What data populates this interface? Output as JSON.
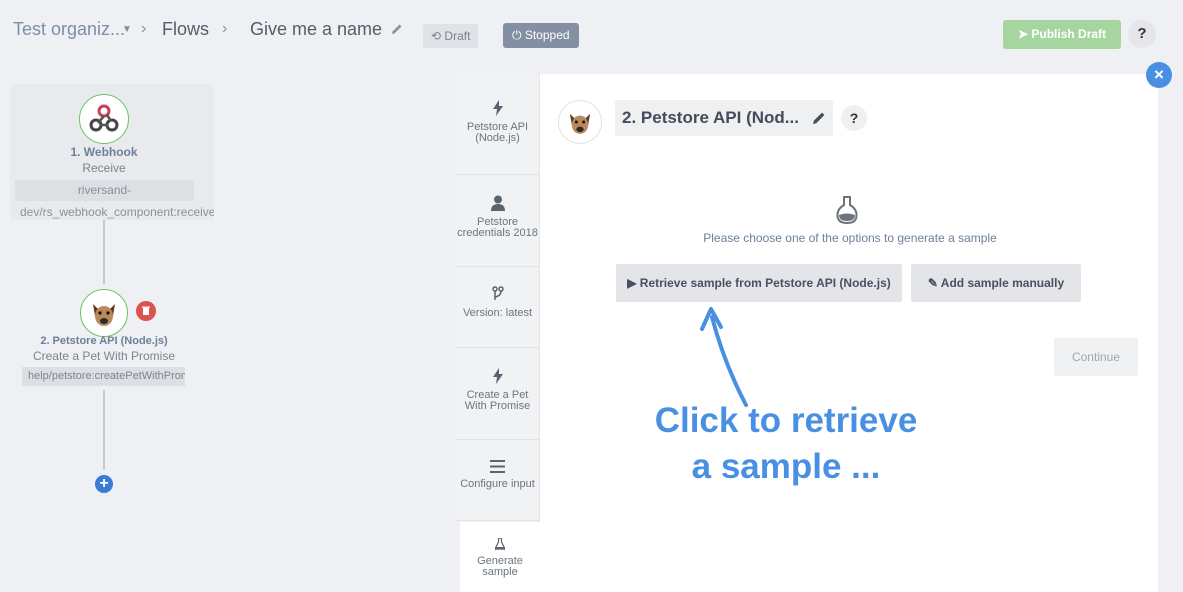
{
  "header": {
    "org": "Test organiz...",
    "flows": "Flows",
    "flow_name": "Give me a name",
    "draft_label": "Draft",
    "stopped_label": "Stopped",
    "publish_label": "Publish Draft",
    "help": "?"
  },
  "canvas": {
    "node1": {
      "title": "1. Webhook",
      "subtitle": "Receive",
      "path_line1": "riversand-",
      "path_line2": "dev/rs_webhook_component:receive"
    },
    "node2": {
      "title": "2. Petstore API (Node.js)",
      "subtitle": "Create a Pet With Promise",
      "path": "help/petstore:createPetWithPromise"
    },
    "add": "+"
  },
  "panel": {
    "close": "×",
    "steps": [
      {
        "label": "Petstore API (Node.js)",
        "icon": "lightning-icon"
      },
      {
        "label": "Petstore credentials 2018",
        "icon": "user-icon"
      },
      {
        "label": "Version: latest",
        "icon": "branch-icon"
      },
      {
        "label": "Create a Pet With Promise",
        "icon": "lightning-icon"
      },
      {
        "label": "Configure input",
        "icon": "menu-icon"
      },
      {
        "label": "Generate sample",
        "icon": "flask-icon"
      }
    ],
    "component_title": "2. Petstore API (Nod...",
    "help": "?",
    "prompt": "Please choose one of the options to generate a sample",
    "retrieve_label": "Retrieve sample from Petstore API (Node.js)",
    "manual_label": "Add sample manually",
    "continue_label": "Continue"
  },
  "annotation": {
    "line1": "Click to retrieve",
    "line2": "a sample ..."
  },
  "colors": {
    "accent": "#4a90e2",
    "publish": "#a6d5a0",
    "stopped": "#8390a4",
    "danger": "#d9534f",
    "node_border": "#6cc26a"
  }
}
